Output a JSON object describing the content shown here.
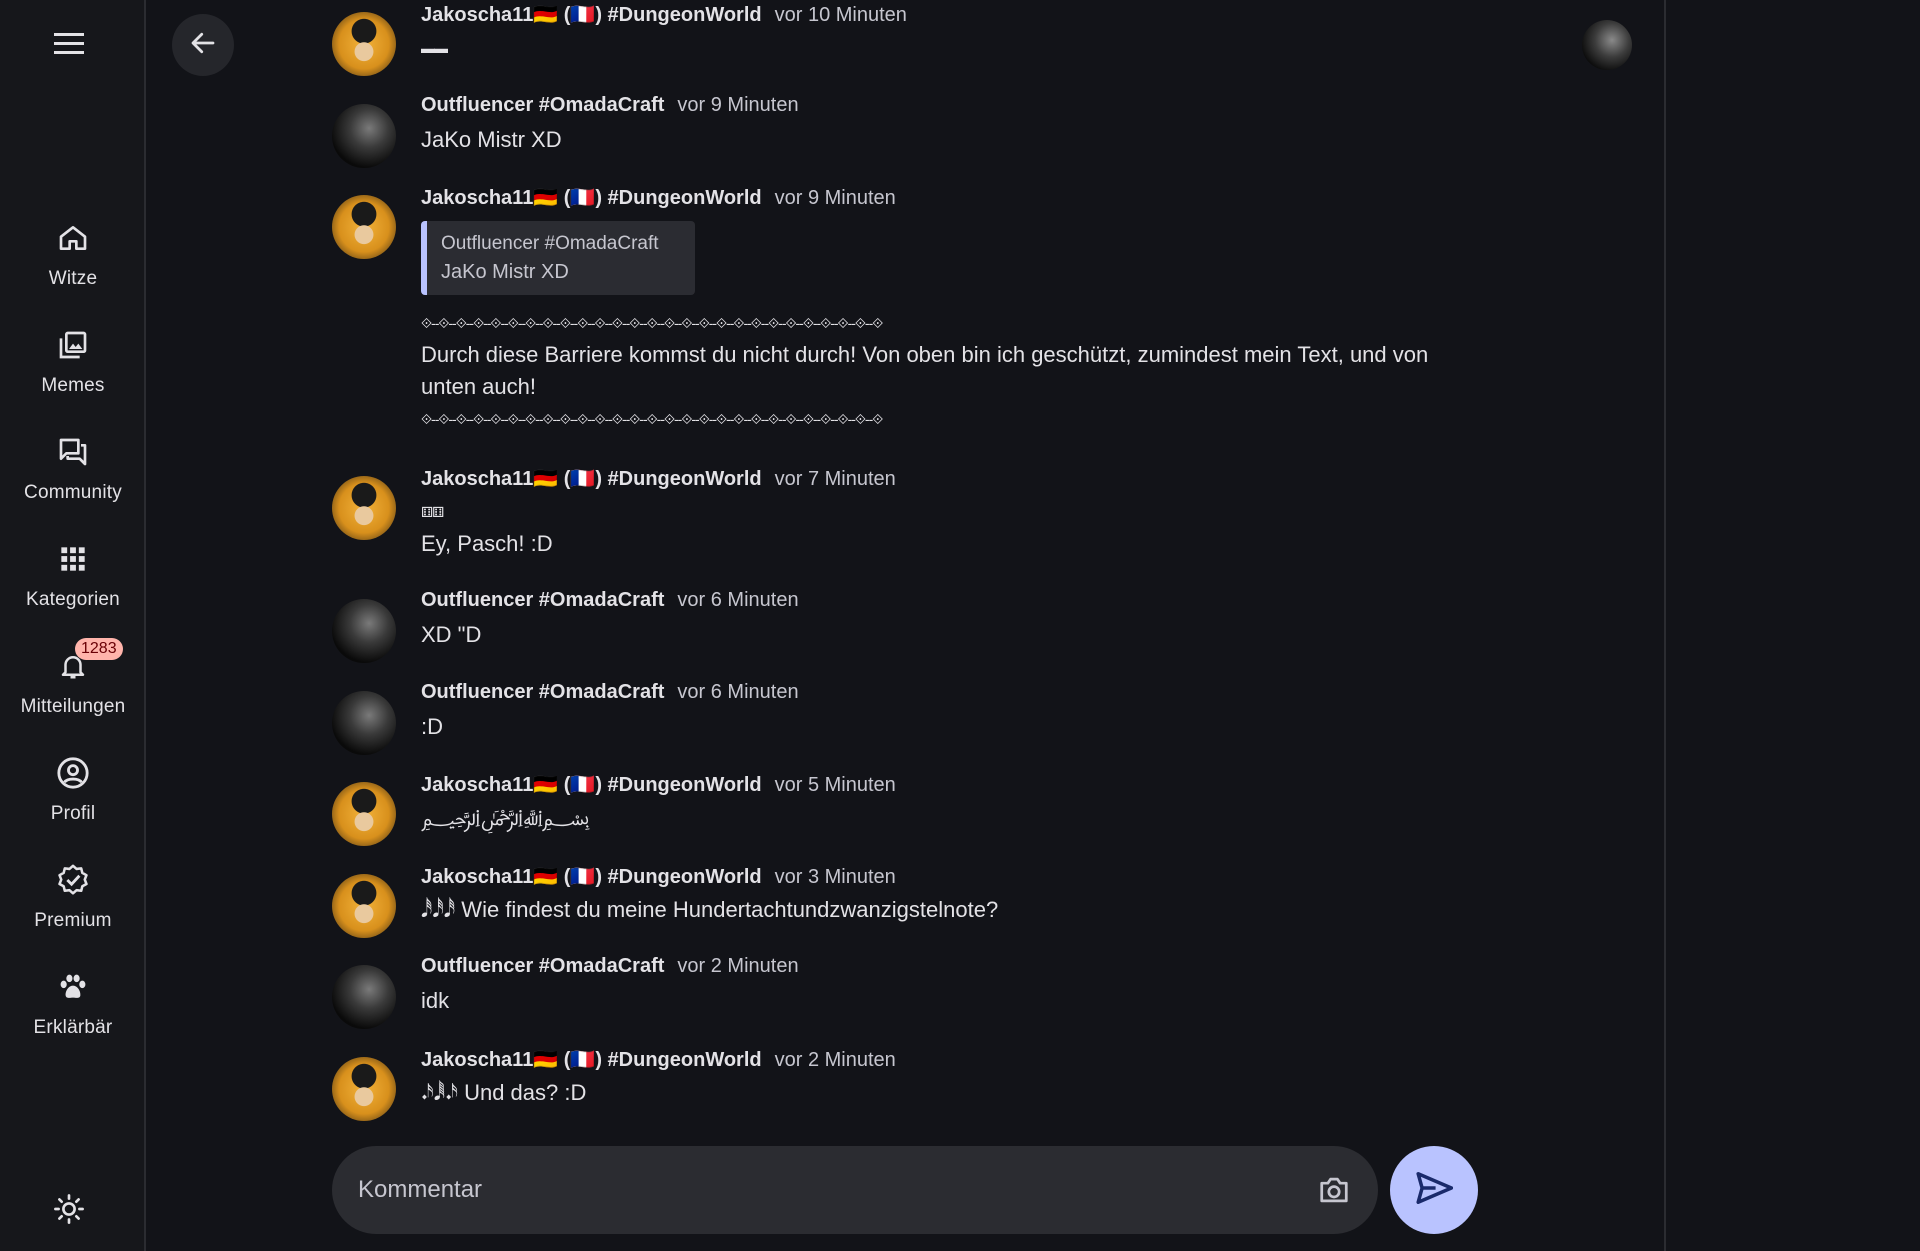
{
  "sidebar": {
    "menu_icon": "hamburger-menu-icon",
    "items": [
      {
        "label": "Witze",
        "icon": "home-icon"
      },
      {
        "label": "Memes",
        "icon": "photo-library-icon"
      },
      {
        "label": "Community",
        "icon": "forum-icon"
      },
      {
        "label": "Kategorien",
        "icon": "apps-grid-icon"
      },
      {
        "label": "Mitteilungen",
        "icon": "bell-icon",
        "badge": "1283"
      },
      {
        "label": "Profil",
        "icon": "account-circle-icon"
      },
      {
        "label": "Premium",
        "icon": "verified-badge-icon"
      },
      {
        "label": "Erklärbär",
        "icon": "paw-icon"
      }
    ],
    "theme_icon": "sun-icon"
  },
  "header": {
    "back_icon": "arrow-back-icon",
    "user_avatar": "user-avatar"
  },
  "messages": [
    {
      "author": "Jakoscha11🇩🇪 (🇫🇷) #DungeonWorld",
      "time": "vor 10 Minuten",
      "text": "▬▬"
    },
    {
      "author": "Outfluencer #OmadaCraft",
      "time": "vor 9 Minuten",
      "text": "JaKo Mistr XD"
    },
    {
      "author": "Jakoscha11🇩🇪 (🇫🇷) #DungeonWorld",
      "time": "vor 9 Minuten",
      "quote": {
        "author": "Outfluencer #OmadaCraft",
        "text": "JaKo Mistr XD"
      },
      "line_top": "⟐‐‐⟐‐‐⟐‐‐⟐‐‐⟐‐‐⟐‐‐⟐‐‐⟐‐‐⟐‐‐⟐‐‐⟐‐‐⟐‐‐⟐‐‐⟐‐‐⟐‐‐⟐‐‐⟐‐‐⟐‐‐⟐‐‐⟐‐‐⟐‐‐⟐‐‐⟐‐‐⟐‐‐⟐‐‐⟐‐‐⟐",
      "text": "Durch diese Barriere kommst du nicht durch! Von oben bin ich geschützt, zumindest mein Text, und von unten auch!",
      "line_bottom": "⟐‐‐⟐‐‐⟐‐‐⟐‐‐⟐‐‐⟐‐‐⟐‐‐⟐‐‐⟐‐‐⟐‐‐⟐‐‐⟐‐‐⟐‐‐⟐‐‐⟐‐‐⟐‐‐⟐‐‐⟐‐‐⟐‐‐⟐‐‐⟐‐‐⟐‐‐⟐‐‐⟐‐‐⟐‐‐⟐‐‐⟐"
    },
    {
      "author": "Jakoscha11🇩🇪 (🇫🇷) #DungeonWorld",
      "time": "vor 7 Minuten",
      "glyphs": "⚅⚅",
      "text": "Ey, Pasch! :D"
    },
    {
      "author": "Outfluencer #OmadaCraft",
      "time": "vor 6 Minuten",
      "text": "XD \"D"
    },
    {
      "author": "Outfluencer #OmadaCraft",
      "time": "vor 6 Minuten",
      "text": ":D"
    },
    {
      "author": "Jakoscha11🇩🇪 (🇫🇷) #DungeonWorld",
      "time": "vor 5 Minuten",
      "text": "﷽"
    },
    {
      "author": "Jakoscha11🇩🇪 (🇫🇷) #DungeonWorld",
      "time": "vor 3 Minuten",
      "text": "𝅘𝅥𝅰𝅘𝅥𝅰𝅘𝅥𝅰 Wie findest du meine Hundertachtundzwanzigstelnote?"
    },
    {
      "author": "Outfluencer #OmadaCraft",
      "time": "vor 2 Minuten",
      "text": "idk"
    },
    {
      "author": "Jakoscha11🇩🇪 (🇫🇷) #DungeonWorld",
      "time": "vor 2 Minuten",
      "text": "𝆺𝅥𝅯𝅘𝅥𝅱𝆺𝅥𝅯 Und das? :D"
    }
  ],
  "composer": {
    "placeholder": "Kommentar",
    "camera_icon": "camera-icon",
    "send_icon": "send-icon"
  }
}
